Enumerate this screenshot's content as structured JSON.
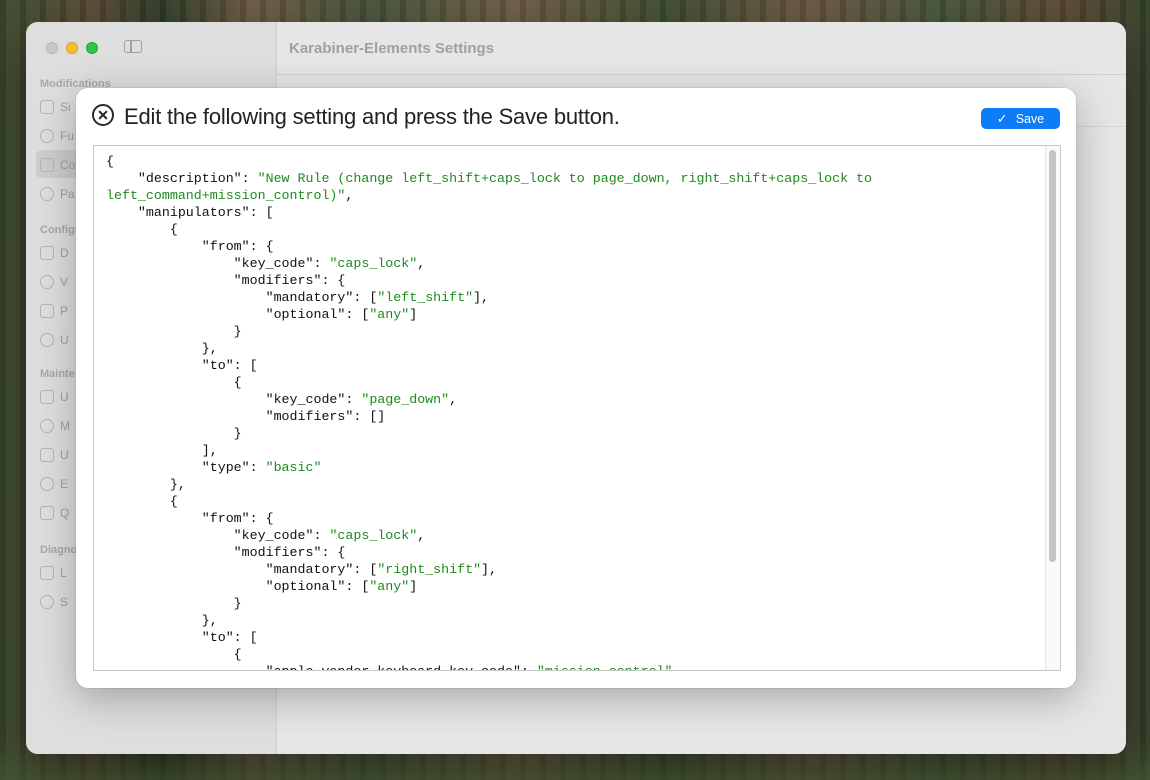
{
  "window": {
    "title": "Karabiner-Elements Settings"
  },
  "sidebar": {
    "sections": [
      {
        "label": "Modifications",
        "items": [
          {
            "label": "Si"
          },
          {
            "label": "Fu"
          },
          {
            "label": "Co"
          },
          {
            "label": "Pa"
          }
        ]
      },
      {
        "label": "Configu",
        "items": [
          {
            "label": "D"
          },
          {
            "label": "V"
          },
          {
            "label": "P"
          },
          {
            "label": "U"
          }
        ]
      },
      {
        "label": "Mainte",
        "items": [
          {
            "label": "U"
          },
          {
            "label": "M"
          },
          {
            "label": "U"
          },
          {
            "label": "E"
          },
          {
            "label": "Q"
          }
        ]
      },
      {
        "label": "Diagno",
        "items": [
          {
            "label": "L"
          },
          {
            "label": "S"
          }
        ]
      }
    ]
  },
  "modal": {
    "title": "Edit the following setting and press the Save button.",
    "save_label": "Save",
    "icons": {
      "close": "close-circle-icon",
      "save": "checkmark-icon"
    },
    "colors": {
      "accent": "#0d7df7",
      "string": "#1d8a1d"
    },
    "code_lines": [
      [
        {
          "t": "{"
        }
      ],
      [
        {
          "t": "    \"description\": "
        },
        {
          "t": "\"New Rule (change left_shift+caps_lock to page_down, right_shift+caps_lock to",
          "s": true
        }
      ],
      [
        {
          "t": "left_command+mission_control)\"",
          "s": true
        },
        {
          "t": ","
        }
      ],
      [
        {
          "t": "    \"manipulators\": ["
        }
      ],
      [
        {
          "t": "        {"
        }
      ],
      [
        {
          "t": "            \"from\": {"
        }
      ],
      [
        {
          "t": "                \"key_code\": "
        },
        {
          "t": "\"caps_lock\"",
          "s": true
        },
        {
          "t": ","
        }
      ],
      [
        {
          "t": "                \"modifiers\": {"
        }
      ],
      [
        {
          "t": "                    \"mandatory\": ["
        },
        {
          "t": "\"left_shift\"",
          "s": true
        },
        {
          "t": "],"
        }
      ],
      [
        {
          "t": "                    \"optional\": ["
        },
        {
          "t": "\"any\"",
          "s": true
        },
        {
          "t": "]"
        }
      ],
      [
        {
          "t": "                }"
        }
      ],
      [
        {
          "t": "            },"
        }
      ],
      [
        {
          "t": "            \"to\": ["
        }
      ],
      [
        {
          "t": "                {"
        }
      ],
      [
        {
          "t": "                    \"key_code\": "
        },
        {
          "t": "\"page_down\"",
          "s": true
        },
        {
          "t": ","
        }
      ],
      [
        {
          "t": "                    \"modifiers\": []"
        }
      ],
      [
        {
          "t": "                }"
        }
      ],
      [
        {
          "t": "            ],"
        }
      ],
      [
        {
          "t": "            \"type\": "
        },
        {
          "t": "\"basic\"",
          "s": true
        }
      ],
      [
        {
          "t": "        },"
        }
      ],
      [
        {
          "t": "        {"
        }
      ],
      [
        {
          "t": "            \"from\": {"
        }
      ],
      [
        {
          "t": "                \"key_code\": "
        },
        {
          "t": "\"caps_lock\"",
          "s": true
        },
        {
          "t": ","
        }
      ],
      [
        {
          "t": "                \"modifiers\": {"
        }
      ],
      [
        {
          "t": "                    \"mandatory\": ["
        },
        {
          "t": "\"right_shift\"",
          "s": true
        },
        {
          "t": "],"
        }
      ],
      [
        {
          "t": "                    \"optional\": ["
        },
        {
          "t": "\"any\"",
          "s": true
        },
        {
          "t": "]"
        }
      ],
      [
        {
          "t": "                }"
        }
      ],
      [
        {
          "t": "            },"
        }
      ],
      [
        {
          "t": "            \"to\": ["
        }
      ],
      [
        {
          "t": "                {"
        }
      ],
      [
        {
          "t": "                    \"apple_vendor_keyboard_key_code\": "
        },
        {
          "t": "\"mission_control\"",
          "s": true
        },
        {
          "t": ","
        }
      ]
    ]
  }
}
